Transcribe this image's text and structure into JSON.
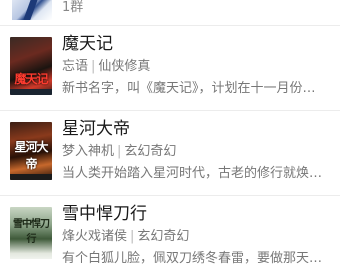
{
  "top_item": {
    "meta": "1群"
  },
  "books": [
    {
      "title": "魔天记",
      "author": "忘语",
      "genre": "仙侠修真",
      "description": "新书名字，叫《魔天记》，计划在十一月份…",
      "cover_text": "魔天记"
    },
    {
      "title": "星河大帝",
      "author": "梦入神机",
      "genre": "玄幻奇幻",
      "description": "当人类开始踏入星河时代，古老的修行就焕…",
      "cover_text": "星河大帝"
    },
    {
      "title": "雪中悍刀行",
      "author": "烽火戏诸侯",
      "genre": "玄幻奇幻",
      "description": "有个白狐儿脸，佩双刀绣冬春雷，要做那天…",
      "cover_text": "雪中悍刀行"
    }
  ],
  "separator": "|"
}
